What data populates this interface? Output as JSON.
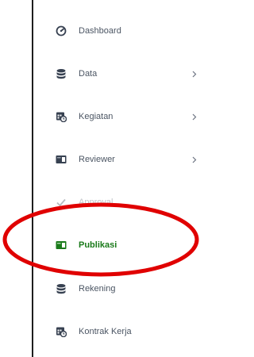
{
  "sidebar": {
    "items": [
      {
        "label": "Dashboard",
        "icon": "dashboard-icon",
        "has_chevron": false
      },
      {
        "label": "Data",
        "icon": "database-icon",
        "has_chevron": true
      },
      {
        "label": "Kegiatan",
        "icon": "calendar-clock-icon",
        "has_chevron": true
      },
      {
        "label": "Reviewer",
        "icon": "reviewer-icon",
        "has_chevron": true
      },
      {
        "label": "Approval",
        "icon": "check-icon",
        "has_chevron": false
      },
      {
        "label": "Publikasi",
        "icon": "publication-icon",
        "has_chevron": false,
        "active": true
      },
      {
        "label": "Rekening",
        "icon": "database-icon",
        "has_chevron": false
      },
      {
        "label": "Kontrak Kerja",
        "icon": "calendar-clock-icon",
        "has_chevron": false
      }
    ],
    "active_color": "#1a7a1a",
    "text_color": "#4b5563",
    "icon_color": "#374151"
  },
  "annotation": {
    "shape": "ellipse",
    "color": "#e00000",
    "target": "Publikasi"
  }
}
